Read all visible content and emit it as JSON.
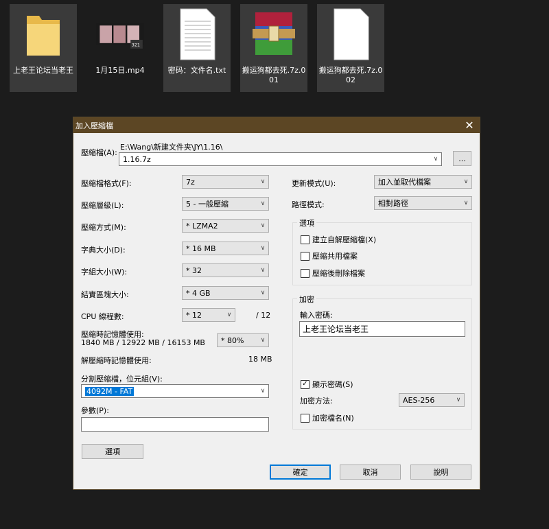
{
  "desktop": {
    "files": [
      {
        "name": "上老王论坛当老王",
        "type": "folder"
      },
      {
        "name": "1月15日.mp4",
        "type": "video"
      },
      {
        "name": "密码：文件名.txt",
        "type": "text"
      },
      {
        "name": "搬运狗都去死.7z.001",
        "type": "rar"
      },
      {
        "name": "搬运狗都去死.7z.002",
        "type": "blank"
      }
    ]
  },
  "dialog": {
    "title": "加入壓縮檔",
    "archive_label": "壓縮檔(A):",
    "archive_path": "E:\\Wang\\新建文件夹\\JY\\1.16\\",
    "archive_name": "1.16.7z",
    "browse_label": "...",
    "format_label": "壓縮檔格式(F):",
    "format_value": "7z",
    "level_label": "壓縮層級(L):",
    "level_value": "5 - 一般壓縮",
    "method_label": "壓縮方式(M):",
    "method_value": "* LZMA2",
    "dict_label": "字典大小(D):",
    "dict_value": "* 16 MB",
    "word_label": "字組大小(W):",
    "word_value": "* 32",
    "solid_label": "結實區塊大小:",
    "solid_value": "* 4 GB",
    "cpu_label": "CPU 線程數:",
    "cpu_value": "* 12",
    "cpu_total": "/ 12",
    "mem_label": "壓縮時記憶體使用:",
    "mem_stats": "1840 MB / 12922 MB / 16153 MB",
    "mem_value": "* 80%",
    "decomp_label": "解壓縮時記憶體使用:",
    "decomp_value": "18 MB",
    "split_label": "分割壓縮檔，位元組(V):",
    "split_value": "4092M - FAT",
    "params_label": "參數(P):",
    "params_value": "",
    "options_button": "選項",
    "update_label": "更新模式(U):",
    "update_value": "加入並取代檔案",
    "path_label": "路徑模式:",
    "path_value": "相對路徑",
    "options_group": {
      "title": "選項",
      "sfx": "建立自解壓縮檔(X)",
      "shared": "壓縮共用檔案",
      "delete": "壓縮後刪除檔案"
    },
    "encrypt_group": {
      "title": "加密",
      "password_label": "輸入密碼:",
      "password_value": "上老王论坛当老王",
      "show_password": "顯示密碼(S)",
      "method_label": "加密方法:",
      "method_value": "AES-256",
      "encrypt_names": "加密檔名(N)"
    },
    "ok_button": "確定",
    "cancel_button": "取消",
    "help_button": "說明"
  }
}
